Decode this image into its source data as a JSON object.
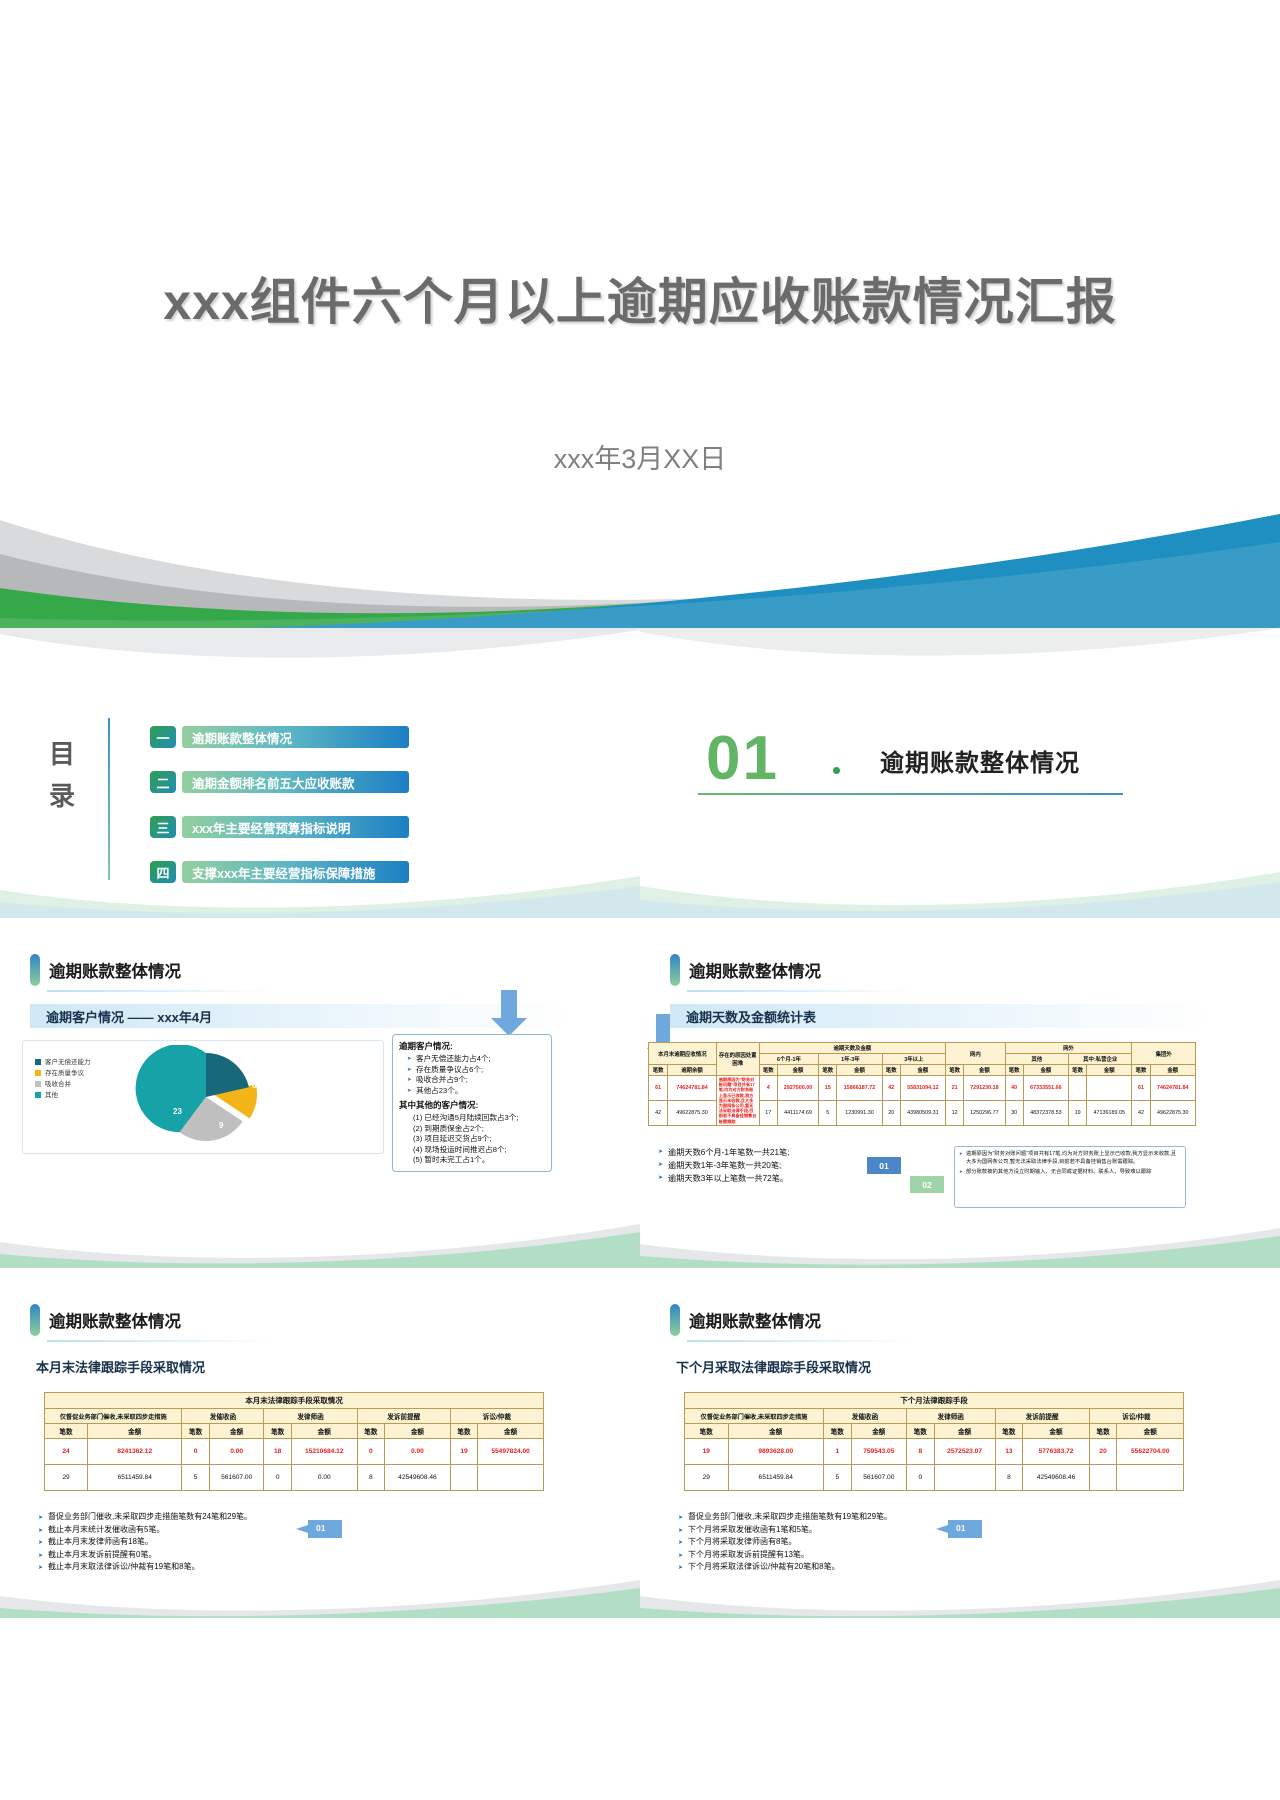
{
  "colors": {
    "green": "#2f9e4f",
    "blue": "#1c7fc4",
    "teal": "#17a2a8",
    "amber": "#f2b418",
    "grey": "#bfbfbf",
    "table_border": "#b99a57",
    "table_header_bg": "#fdf3d3",
    "red_text": "#e8221c"
  },
  "slide1": {
    "title": "xxx组件六个月以上逾期应收账款情况汇报",
    "subtitle": "xxx年3月XX日"
  },
  "slide2": {
    "label": "目录",
    "items": [
      {
        "num": "一",
        "label": "逾期账款整体情况"
      },
      {
        "num": "二",
        "label": "逾期金额排名前五大应收账款"
      },
      {
        "num": "三",
        "label": "xxx年主要经营预算指标说明"
      },
      {
        "num": "四",
        "label": "支撑xxx年主要经营指标保障措施"
      }
    ]
  },
  "slide3": {
    "number": "01",
    "title": "逾期账款整体情况"
  },
  "slide4": {
    "head": "逾期账款整体情况",
    "banner": "逾期客户情况 —— xxx年4月",
    "chart_data": {
      "type": "pie",
      "title": "逾期客户情况",
      "legend_position": "left",
      "categories": [
        "客户无偿还能力",
        "存在质量争议",
        "吸收合并",
        "其他"
      ],
      "values": [
        4,
        6,
        9,
        23
      ],
      "data_labels": [
        "4",
        "6",
        "9",
        "23"
      ],
      "colors": [
        "#17697a",
        "#f2b418",
        "#bfbfbf",
        "#17a2a8"
      ]
    },
    "callout": {
      "title": "逾期客户情况:",
      "bullets": [
        "客户无偿还能力占4个;",
        "存在质量争议占6个;",
        "吸收合并占9个;",
        "其他占23个。"
      ],
      "subtitle": "其中其他的客户情况:",
      "numbered": [
        "(1)  已经沟通5月陆续回款占3个;",
        "(2)  到期质保金占2个;",
        "(3)  项目延迟交货占9个;",
        "(4)  现场投运时间推迟占8个;",
        "(5)  暂时未完工占1个。"
      ]
    }
  },
  "slide5": {
    "head": "逾期账款整体情况",
    "banner": "逾期天数及金额统计表",
    "table": {
      "group_headers": [
        "本月末逾期应收情况",
        "存在的原因处置困难",
        "逾期天数及金额",
        "网内",
        "网外",
        "集团外"
      ],
      "sub_group_headers": [
        "6个月-1年",
        "1年-3年",
        "3年以上",
        "其中:私营企业"
      ],
      "col_headers": [
        "笔数",
        "逾期余额",
        "",
        "笔数",
        "金额",
        "笔数",
        "金额",
        "笔数",
        "金额",
        "笔数",
        "金额",
        "笔数",
        "金额",
        "笔数",
        "金额",
        "笔数",
        "金额"
      ],
      "rows": [
        {
          "highlight": true,
          "cells": [
            "61",
            "74624781.84",
            "逾期原因为\"财务对账问题\"项目共有17笔,均为对方财务账上显示已收款,我方显示未收款,且大多为图网条公司,暂无法采取法律手段,目前若不具备挂销售台账需跟踪",
            "4",
            "2927500.00",
            "15",
            "15866187.72",
            "42",
            "55831094.12",
            "21",
            "7291230.18",
            "40",
            "67333551.66",
            "",
            "",
            "61",
            "74624781.84"
          ]
        },
        {
          "highlight": false,
          "cells": [
            "42",
            "49622875.30",
            "",
            "17",
            "4411174.69",
            "5",
            "1230991.30",
            "20",
            "43980509.31",
            "12",
            "1250296.77",
            "30",
            "48372378.53",
            "19",
            "47136189.05",
            "42",
            "49622875.30"
          ]
        }
      ]
    },
    "bullets": [
      "逾期天数6个月-1年笔数一共21笔;",
      "逾期天数1年-3年笔数一共20笔;",
      "逾期天数3年以上笔数一共72笔。"
    ],
    "tag1": "01",
    "tag2": "02",
    "notes": [
      "逾期原因为\"财务对账问题\"项目共有17笔,均为对方财务账上显示已收款,我方显示未收款,且大多为国网条公司,暂无法采取法律手段,目前若不具备挂销售台账需跟踪。",
      "部分账款被的其他方设立时期输入、无合同或证据材料、联系人、导致难以跟踪"
    ]
  },
  "slide6": {
    "head": "逾期账款整体情况",
    "banner": "本月末法律跟踪手段采取情况",
    "table": {
      "title": "本月末法律跟踪手段采取情况",
      "group_headers": [
        "仅督促业务部门催收,未采取四步走措施",
        "发催收函",
        "发律师函",
        "发诉前提醒",
        "诉讼/仲裁"
      ],
      "col_headers": [
        "笔数",
        "金额",
        "笔数",
        "金额",
        "笔数",
        "金额",
        "笔数",
        "金额",
        "笔数",
        "金额"
      ],
      "rows": [
        {
          "highlight": true,
          "cells": [
            "24",
            "8241362.12",
            "0",
            "0.00",
            "18",
            "15210684.12",
            "0",
            "0.00",
            "19",
            "55497824.00"
          ]
        },
        {
          "highlight": false,
          "cells": [
            "29",
            "6511459.84",
            "5",
            "561607.00",
            "0",
            "0.00",
            "8",
            "42549608.46",
            "",
            ""
          ]
        }
      ]
    },
    "bullets": [
      "督促业务部门催收,未采取四步走措施笔数有24笔和29笔。",
      "截止本月末统计发催收函有5笔。",
      "截止本月末发律师函有18笔。",
      "截止本月末发诉前提醒有0笔。",
      "截止本月末取法律诉讼/仲裁有19笔和8笔。"
    ],
    "tag": "01"
  },
  "slide7": {
    "head": "逾期账款整体情况",
    "banner": "下个月采取法律跟踪手段采取情况",
    "table": {
      "title": "下个月法律跟踪手段",
      "group_headers": [
        "仅督促业务部门催收,未采取四步走措施",
        "发催收函",
        "发律师函",
        "发诉前提醒",
        "诉讼/仲裁"
      ],
      "col_headers": [
        "笔数",
        "金额",
        "笔数",
        "金额",
        "笔数",
        "金额",
        "笔数",
        "金额",
        "笔数",
        "金额"
      ],
      "rows": [
        {
          "highlight": true,
          "cells": [
            "19",
            "9893628.00",
            "1",
            "759543.05",
            "8",
            "2572523.07",
            "13",
            "5776383.72",
            "20",
            "55622704.00"
          ]
        },
        {
          "highlight": false,
          "cells": [
            "29",
            "6511459.84",
            "5",
            "561607.00",
            "0",
            "",
            "8",
            "42549608.46",
            "",
            ""
          ]
        }
      ]
    },
    "bullets": [
      "督促业务部门催收,未采取四步走措施笔数有19笔和29笔。",
      "下个月将采取发催收函有1笔和5笔。",
      "下个月将采取发律师函有8笔。",
      "下个月将采取发诉前提醒有13笔。",
      "下个月将采取法律诉讼/仲裁有20笔和8笔。"
    ],
    "tag": "01"
  }
}
